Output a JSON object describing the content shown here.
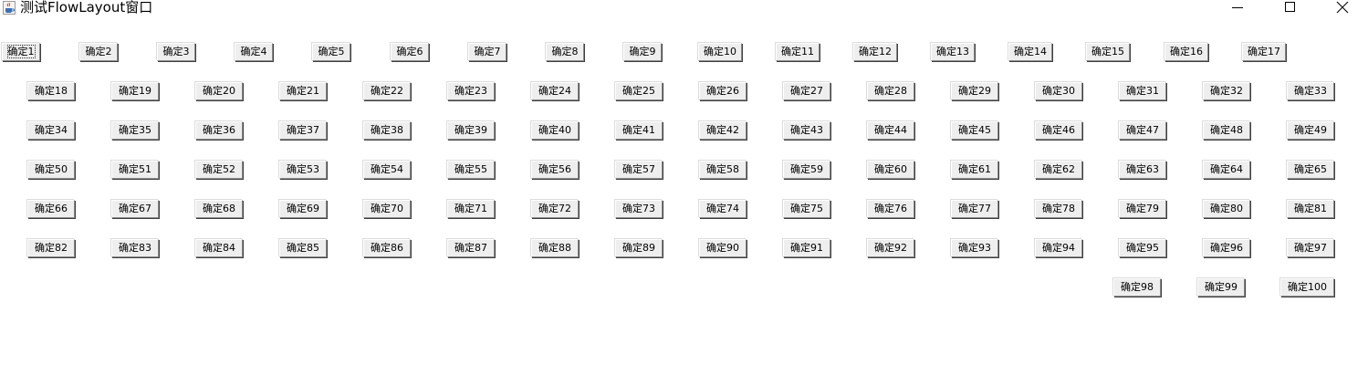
{
  "window": {
    "title": "测试FlowLayout窗口",
    "icon": "java-cup-icon",
    "controls": [
      "minimize-icon",
      "maximize-icon",
      "close-icon"
    ]
  },
  "buttons": [
    "确定1",
    "确定2",
    "确定3",
    "确定4",
    "确定5",
    "确定6",
    "确定7",
    "确定8",
    "确定9",
    "确定10",
    "确定11",
    "确定12",
    "确定13",
    "确定14",
    "确定15",
    "确定16",
    "确定17",
    "确定18",
    "确定19",
    "确定20",
    "确定21",
    "确定22",
    "确定23",
    "确定24",
    "确定25",
    "确定26",
    "确定27",
    "确定28",
    "确定29",
    "确定30",
    "确定31",
    "确定32",
    "确定33",
    "确定34",
    "确定35",
    "确定36",
    "确定37",
    "确定38",
    "确定39",
    "确定40",
    "确定41",
    "确定42",
    "确定43",
    "确定44",
    "确定45",
    "确定46",
    "确定47",
    "确定48",
    "确定49",
    "确定50",
    "确定51",
    "确定52",
    "确定53",
    "确定54",
    "确定55",
    "确定56",
    "确定57",
    "确定58",
    "确定59",
    "确定60",
    "确定61",
    "确定62",
    "确定63",
    "确定64",
    "确定65",
    "确定66",
    "确定67",
    "确定68",
    "确定69",
    "确定70",
    "确定71",
    "确定72",
    "确定73",
    "确定74",
    "确定75",
    "确定76",
    "确定77",
    "确定78",
    "确定79",
    "确定80",
    "确定81",
    "确定82",
    "确定83",
    "确定84",
    "确定85",
    "确定86",
    "确定87",
    "确定88",
    "确定89",
    "确定90",
    "确定91",
    "确定92",
    "确定93",
    "确定94",
    "确定95",
    "确定96",
    "确定97",
    "确定98",
    "确定99",
    "确定100"
  ],
  "focused_button": "确定1"
}
